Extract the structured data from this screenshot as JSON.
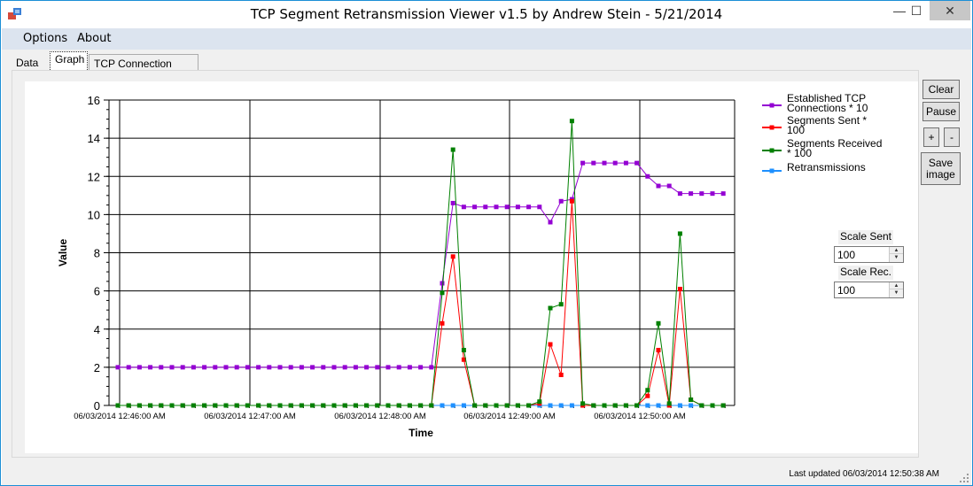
{
  "window": {
    "title": "TCP Segment Retransmission Viewer v1.5 by Andrew Stein - 5/21/2014",
    "icon": "app-icon",
    "controls": {
      "minimize": "—",
      "maximize": "☐",
      "close": "✕"
    }
  },
  "menu": {
    "items": [
      "Options",
      "About"
    ]
  },
  "tabs": [
    {
      "label": "Data"
    },
    {
      "label": "Graph",
      "active": true
    },
    {
      "label": "TCP Connection Details"
    }
  ],
  "buttons": {
    "clear": "Clear",
    "pause": "Pause",
    "plus": "+",
    "minus": "-",
    "save": "Save image"
  },
  "scale": {
    "sent_label": "Scale Sent",
    "sent_value": "100",
    "rec_label": "Scale Rec.",
    "rec_value": "100"
  },
  "status": {
    "text": "Last updated 06/03/2014 12:50:38 AM"
  },
  "chart_data": {
    "type": "line",
    "title": "",
    "xlabel": "Time",
    "ylabel": "Value",
    "ylim": [
      0,
      16
    ],
    "yticks": [
      0,
      2,
      4,
      6,
      8,
      10,
      12,
      14,
      16
    ],
    "xtick_labels": [
      "06/03/2014 12:46:00 AM",
      "06/03/2014 12:47:00 AM",
      "06/03/2014 12:48:00 AM",
      "06/03/2014 12:49:00 AM",
      "06/03/2014 12:50:00 AM"
    ],
    "x_start": "12:46:00",
    "x_interval_seconds": 2.5,
    "grid": true,
    "legend_position": "top-right",
    "series": [
      {
        "name": "Established TCP Connections * 10",
        "color": "#9400d3",
        "values": [
          2,
          2,
          2,
          2,
          2,
          2,
          2,
          2,
          2,
          2,
          2,
          2,
          2,
          2,
          2,
          2,
          2,
          2,
          2,
          2,
          2,
          2,
          2,
          2,
          2,
          2,
          2,
          2,
          2,
          2,
          6.4,
          10.6,
          10.4,
          10.4,
          10.4,
          10.4,
          10.4,
          10.4,
          10.4,
          10.4,
          9.6,
          10.7,
          10.8,
          12.7,
          12.7,
          12.7,
          12.7,
          12.7,
          12.7,
          12,
          11.5,
          11.5,
          11.1,
          11.1,
          11.1,
          11.1,
          11.1
        ]
      },
      {
        "name": "Segments Sent * 100",
        "color": "#ff0000",
        "values": [
          0,
          0,
          0,
          0,
          0,
          0,
          0,
          0,
          0,
          0,
          0,
          0,
          0,
          0,
          0,
          0,
          0,
          0,
          0,
          0,
          0,
          0,
          0,
          0,
          0,
          0,
          0,
          0,
          0,
          0,
          4.3,
          7.8,
          2.4,
          0,
          0,
          0,
          0,
          0,
          0,
          0.1,
          3.2,
          1.6,
          10.7,
          0,
          0,
          0,
          0,
          0,
          0,
          0.5,
          2.9,
          0,
          6.1,
          0.3,
          0,
          0,
          0
        ]
      },
      {
        "name": "Segments Received * 100",
        "color": "#008000",
        "values": [
          0,
          0,
          0,
          0,
          0,
          0,
          0,
          0,
          0,
          0,
          0,
          0,
          0,
          0,
          0,
          0,
          0,
          0,
          0,
          0,
          0,
          0,
          0,
          0,
          0,
          0,
          0,
          0,
          0,
          0,
          5.9,
          13.4,
          2.9,
          0,
          0,
          0,
          0,
          0,
          0,
          0.2,
          5.1,
          5.3,
          14.9,
          0.1,
          0,
          0,
          0,
          0,
          0,
          0.8,
          4.3,
          0.1,
          9,
          0.3,
          0,
          0,
          0
        ]
      },
      {
        "name": "Retransmissions",
        "color": "#1e90ff",
        "values": [
          0,
          0,
          0,
          0,
          0,
          0,
          0,
          0,
          0,
          0,
          0,
          0,
          0,
          0,
          0,
          0,
          0,
          0,
          0,
          0,
          0,
          0,
          0,
          0,
          0,
          0,
          0,
          0,
          0,
          0,
          0,
          0,
          0,
          0,
          0,
          0,
          0,
          0,
          0,
          0,
          0,
          0,
          0,
          0,
          0,
          0,
          0,
          0,
          0,
          0,
          0,
          0,
          0,
          0,
          0,
          0,
          0
        ]
      }
    ],
    "legend_labels": [
      [
        "Established TCP",
        "Connections * 10"
      ],
      [
        "Segments Sent *",
        "100"
      ],
      [
        "Segments Received",
        "* 100"
      ],
      [
        "Retransmissions"
      ]
    ]
  }
}
